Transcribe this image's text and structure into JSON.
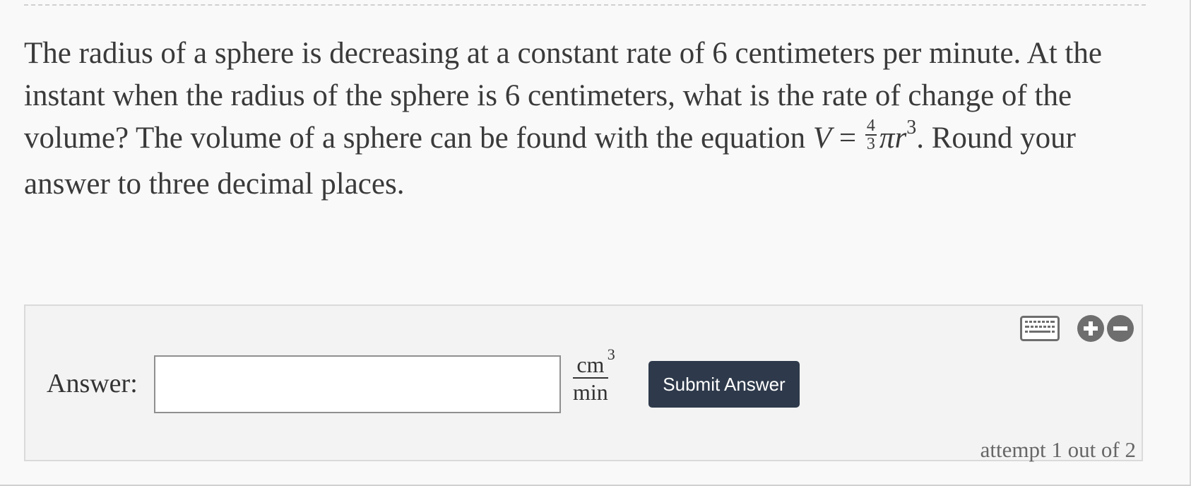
{
  "question": {
    "text_part1": "The radius of a sphere is decreasing at a constant rate of 6 centimeters per minute. At the instant when the radius of the sphere is ",
    "radius_value": "6",
    "text_part2": " centimeters, what is the rate of change of the volume? The volume of a sphere can be found with the equation ",
    "formula_lhs": "V",
    "formula_eq": " = ",
    "frac_num": "4",
    "frac_den": "3",
    "formula_rhs": "πr",
    "formula_exp": "3",
    "formula_end": ".",
    "text_part3": " Round your answer to three decimal places."
  },
  "answer": {
    "label": "Answer:",
    "input_value": "",
    "input_placeholder": "",
    "unit_num": "cm",
    "unit_exp": "3",
    "unit_den": "min",
    "submit_label": "Submit Answer",
    "attempt_text": "attempt 1 out of 2"
  },
  "icons": {
    "keyboard": "keyboard-icon",
    "zoom_in": "plus-circle-icon",
    "zoom_out": "minus-circle-icon"
  },
  "colors": {
    "button_bg": "#2e3a4b",
    "icon_gray": "#6e6e6e"
  }
}
